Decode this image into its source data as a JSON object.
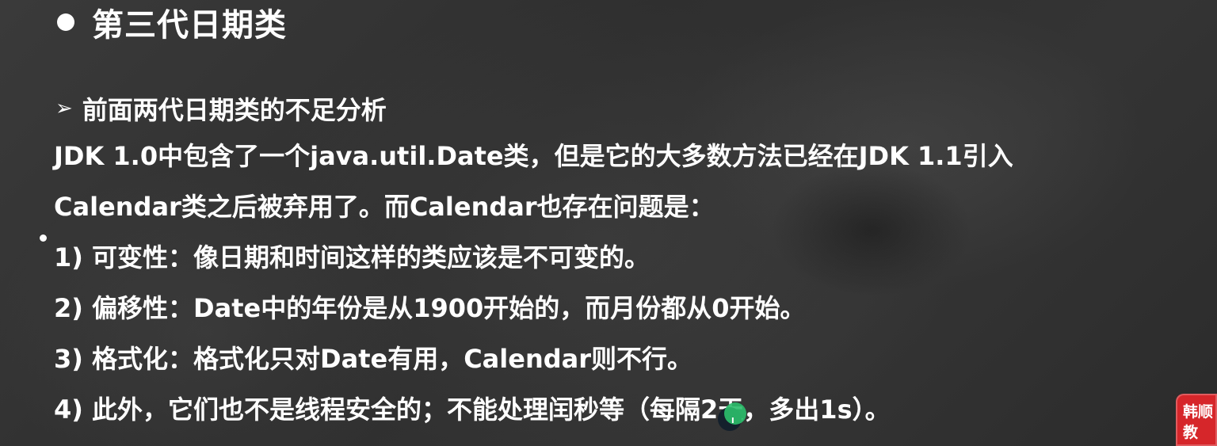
{
  "slide": {
    "title": "第三代日期类",
    "subtitle": "前面两代日期类的不足分析",
    "lines": [
      "JDK 1.0中包含了一个java.util.Date类，但是它的大多数方法已经在JDK 1.1引入",
      "Calendar类之后被弃用了。而Calendar也存在问题是：",
      "1) 可变性：像日期和时间这样的类应该是不可变的。",
      "2) 偏移性：Date中的年份是从1900开始的，而月份都从0开始。",
      "3) 格式化：格式化只对Date有用，Calendar则不行。",
      "4) 此外，它们也不是线程安全的；不能处理闰秒等（每隔2天，多出1s）。"
    ]
  },
  "logo": {
    "line1": "韩顺",
    "line2": "教"
  },
  "icons": {
    "title_bullet": "filled-circle-bullet",
    "subtitle_arrow": "arrowhead-bullet",
    "overlay": "cursor-badge-icon"
  },
  "colors": {
    "background": "#333333",
    "text": "#ffffff",
    "logo": "#d6262a",
    "cursor_badge": "#2bbf6b"
  }
}
